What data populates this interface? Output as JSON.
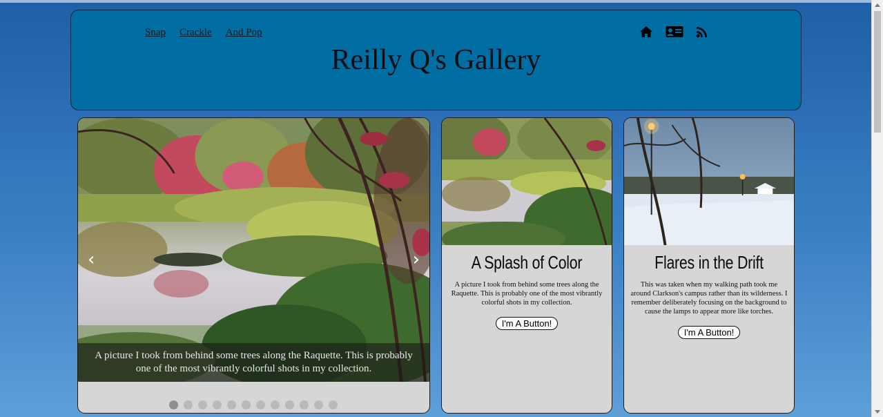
{
  "nav": {
    "links": [
      "Snap",
      "Crackle",
      "And Pop"
    ]
  },
  "header": {
    "title": "Reilly Q's Gallery"
  },
  "icons": {
    "home": "home-icon",
    "contact": "contact-card-icon",
    "rss": "rss-icon"
  },
  "carousel": {
    "caption": "A picture I took from behind some trees along the Raquette. This is probably one of the most vibrantly colorful shots in my collection.",
    "prev": "‹",
    "next": "›",
    "slide_count": 12,
    "active_index": 0
  },
  "cards": [
    {
      "title": "A Splash of Color",
      "text": "A picture I took from behind some trees along the Raquette. This is probably one of the most vibrantly colorful shots in my collection.",
      "button": "I'm A Button!"
    },
    {
      "title": "Flares in the Drift",
      "text": "This was taken when my walking path took me around Clarkson's campus rather than its wilderness. I remember deliberately focusing on the background to cause the lamps to appear more like torches.",
      "button": "I'm A Button!"
    }
  ],
  "colors": {
    "header_bg": "#006da3",
    "card_bg": "#d6d6d6",
    "page_bg": "#2a6db6"
  }
}
